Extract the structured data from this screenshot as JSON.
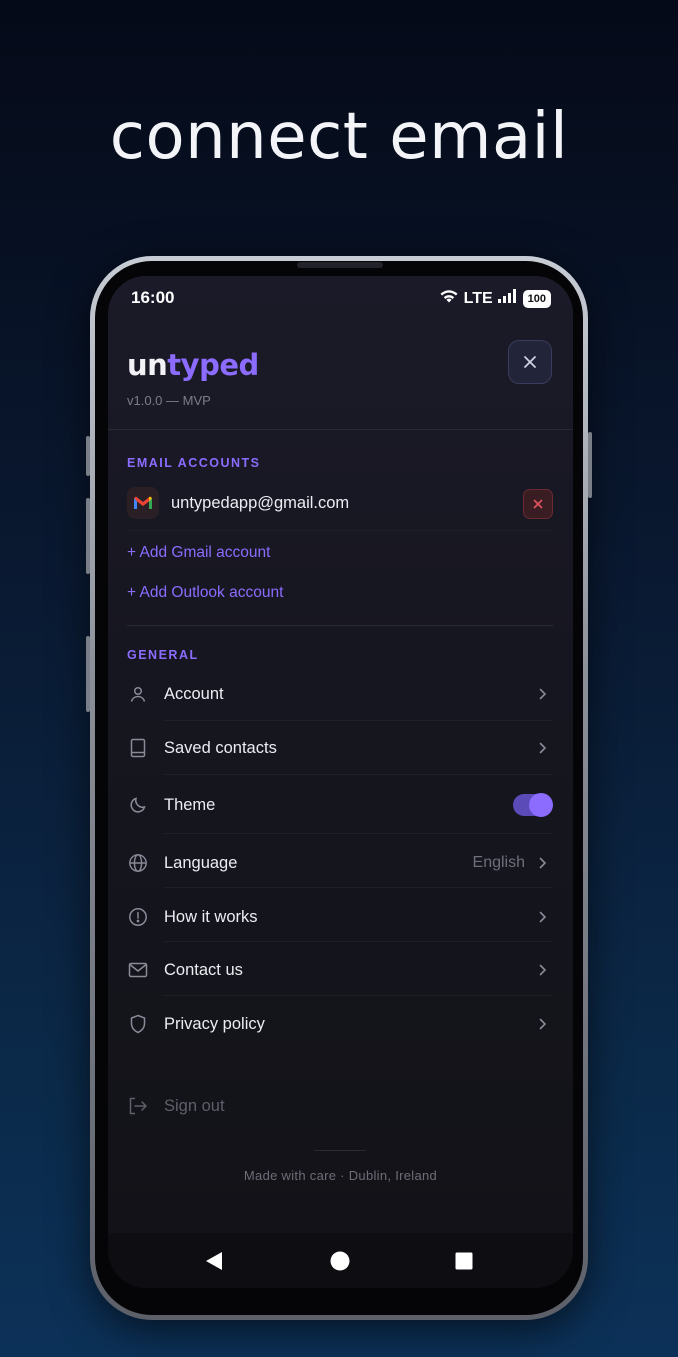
{
  "headline": "connect email",
  "status_bar": {
    "time": "16:00",
    "network": "LTE",
    "battery": "100"
  },
  "brand": {
    "name_part1": "un",
    "name_part2": "typed",
    "version": "v1.0.0 — MVP"
  },
  "email_accounts": {
    "section_label": "EMAIL ACCOUNTS",
    "accounts": [
      {
        "email": "untypedapp@gmail.com",
        "provider_icon": "gmail-icon"
      }
    ],
    "add_gmail": "+ Add Gmail account",
    "add_outlook": "+ Add Outlook account"
  },
  "general": {
    "section_label": "GENERAL",
    "items": [
      {
        "label": "Account",
        "icon": "user-icon"
      },
      {
        "label": "Saved contacts",
        "icon": "book-icon"
      },
      {
        "label": "Theme",
        "icon": "moon-icon",
        "toggle_on": true
      },
      {
        "label": "Language",
        "icon": "globe-icon",
        "value": "English"
      },
      {
        "label": "How it works",
        "icon": "info-icon"
      },
      {
        "label": "Contact us",
        "icon": "mail-icon"
      },
      {
        "label": "Privacy policy",
        "icon": "shield-icon"
      }
    ]
  },
  "sign_out": {
    "label": "Sign out",
    "icon": "logout-icon"
  },
  "footer": "Made with care · Dublin, Ireland",
  "colors": {
    "accent": "#8b6cff",
    "danger": "#e0535f",
    "background": "#121217"
  }
}
